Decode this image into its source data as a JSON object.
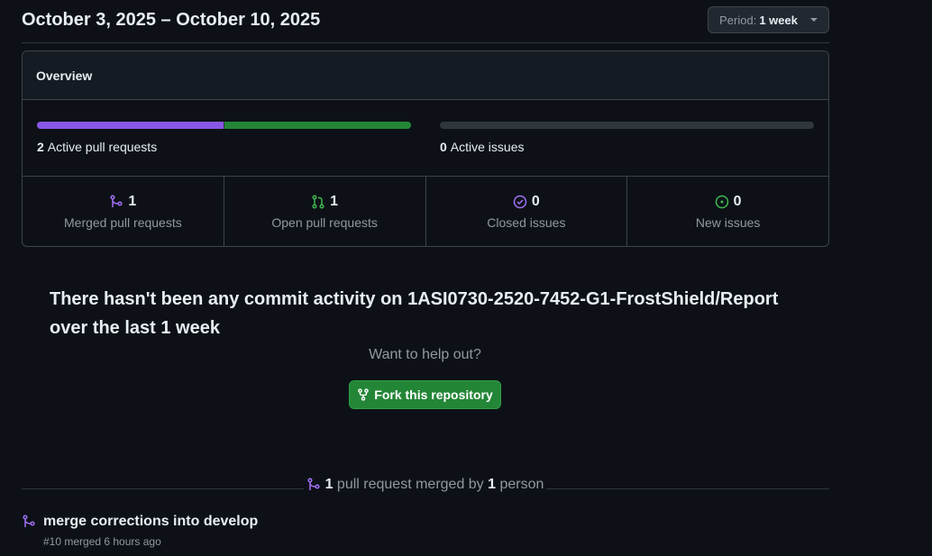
{
  "header": {
    "date_range": "October 3, 2025 – October 10, 2025",
    "period_label": "Period:",
    "period_value": "1 week"
  },
  "overview": {
    "title": "Overview",
    "pull_requests": {
      "count": "2",
      "label": "Active pull requests"
    },
    "issues": {
      "count": "0",
      "label": "Active issues"
    },
    "stats": [
      {
        "icon": "git-merge-icon",
        "value": "1",
        "label": "Merged pull requests",
        "color": "#a371f7"
      },
      {
        "icon": "git-pull-request-icon",
        "value": "1",
        "label": "Open pull requests",
        "color": "#3fb950"
      },
      {
        "icon": "issue-closed-icon",
        "value": "0",
        "label": "Closed issues",
        "color": "#a371f7"
      },
      {
        "icon": "issue-opened-icon",
        "value": "0",
        "label": "New issues",
        "color": "#3fb950"
      }
    ]
  },
  "blankslate": {
    "title": "There hasn't been any commit activity on 1ASI0730-2520-7452-G1-FrostShield/Report over the last 1 week",
    "help_text": "Want to help out?",
    "fork_button": "Fork this repository"
  },
  "summary": {
    "count": "1",
    "text_middle": "pull request merged by",
    "people": "1",
    "text_end": "person"
  },
  "merged_prs": [
    {
      "title": "merge corrections into develop",
      "meta": "#10 merged 6 hours ago"
    }
  ],
  "colors": {
    "background": "#0d1117",
    "merged": "#8957e5",
    "open": "#238636",
    "accent_button": "#238636"
  }
}
